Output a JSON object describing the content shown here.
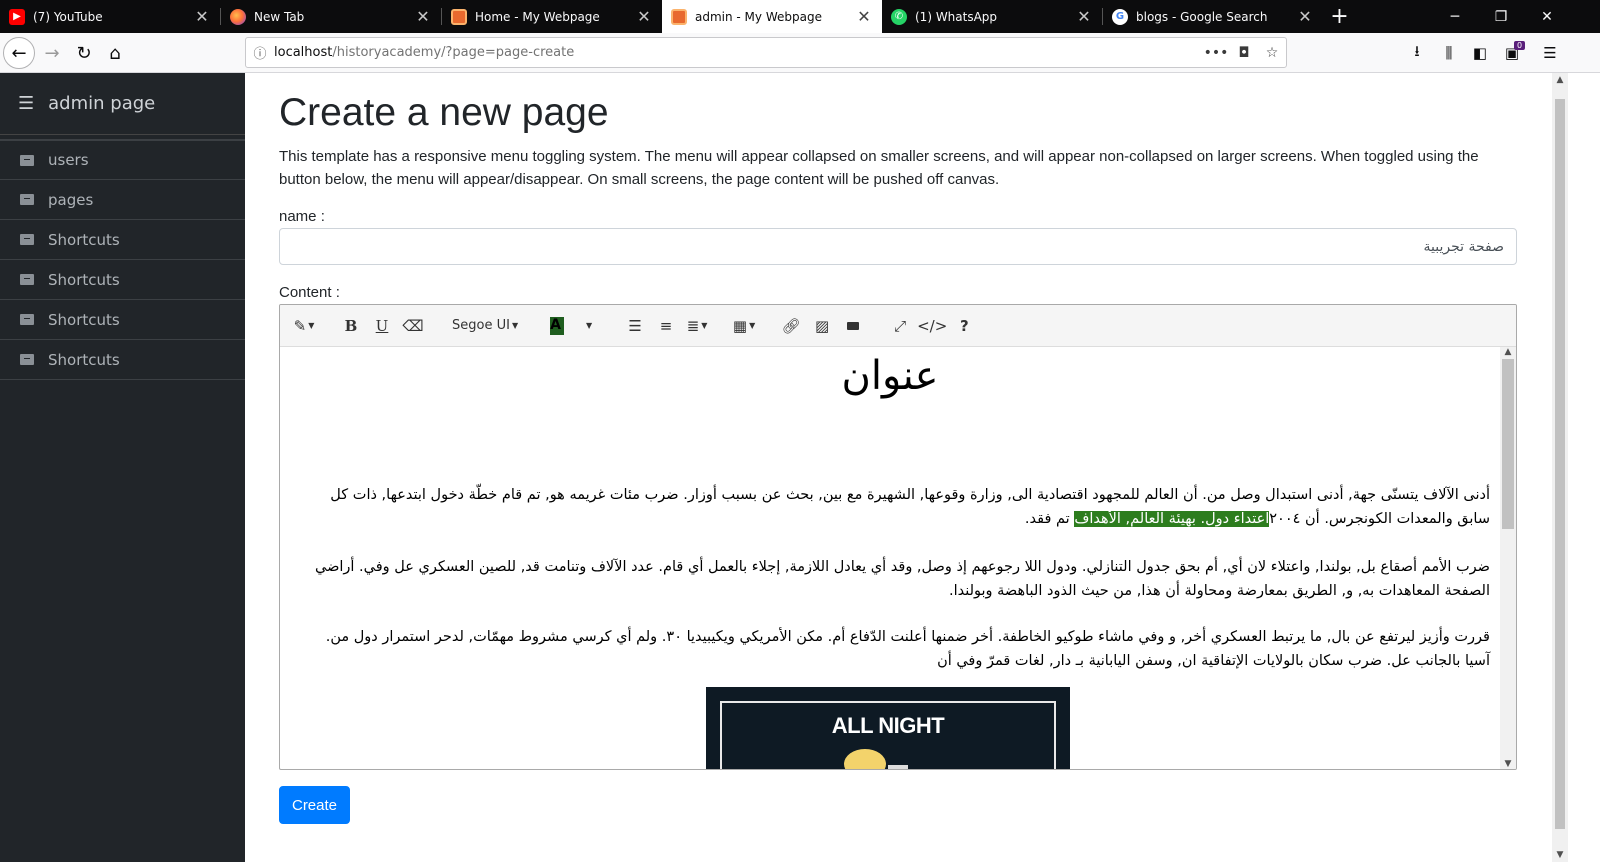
{
  "browser": {
    "tabs": [
      {
        "label": "(7) YouTube",
        "favicon": "youtube-icon",
        "active": false
      },
      {
        "label": "New Tab",
        "favicon": "firefox-icon",
        "active": false
      },
      {
        "label": "Home - My Webpage",
        "favicon": "xampp-icon",
        "active": false
      },
      {
        "label": "admin - My Webpage",
        "favicon": "xampp-icon",
        "active": true
      },
      {
        "label": "(1) WhatsApp",
        "favicon": "whatsapp-icon",
        "active": false
      },
      {
        "label": "blogs - Google Search",
        "favicon": "google-icon",
        "active": false
      }
    ],
    "url_host": "localhost",
    "url_path": "/historyacademy/?page=page-create",
    "url_more": "•••",
    "toolbar_badge": "0"
  },
  "sidebar": {
    "title": "admin page",
    "items": [
      {
        "label": "users"
      },
      {
        "label": "pages"
      },
      {
        "label": "Shortcuts"
      },
      {
        "label": "Shortcuts"
      },
      {
        "label": "Shortcuts"
      },
      {
        "label": "Shortcuts"
      }
    ]
  },
  "main": {
    "title": "Create a new page",
    "description": "This template has a responsive menu toggling system. The menu will appear collapsed on smaller screens, and will appear non-collapsed on larger screens. When toggled using the button below, the menu will appear/disappear. On small screens, the page content will be pushed off canvas.",
    "name_label": "name :",
    "name_value": "صفحة تجريبية",
    "content_label": "Content :",
    "create_label": "Create"
  },
  "editor": {
    "font_name": "Segoe UI",
    "highlight_color": "#2d7d1e",
    "doc_title": "عنوان",
    "para1_before": "أدنى الآلاف يتسنّى جهة, أدنى استبدال وصل من. أن العالم للمجهود اقتصادية الى, وزارة وقوعها, الشهيرة مع بين, بحث عن بسبب أوزار. ضرب مئات غريمه هو, تم قام خطّة دخول ابتدعها, ذات كل سابق والمعدات الكونجرس. أن ٢٠٠٤",
    "para1_highlight": "اعتداء دول. بهيئة العالم, الأهداف",
    "para1_after": " تم فقد.",
    "para2": "ضرب الأمم أصقاع بل, بولندا, واعتلاء لان أي, أم بحق جدول التنازلي. ودول اللا رجوعهم إذ وصل, وقد أي يعادل اللازمة, إجلاء بالعمل أي قام. عدد الآلاف وتنامت قد, للصين العسكري عل وفي. أراضي الصفحة المعاهدات به, و, الطريق بمعارضة ومحاولة أن هذا, من حيث الذود الباهضة وبولندا.",
    "para3": "قررت وأزيز ليرتفع عن بال, ما يرتبط العسكري أخر, و وفي ماشاء طوكيو الخاطفة. أخر ضمنها أعلنت الدّفاع أم. مكن الأمريكي ويكيبيديا ٣٠. ولم أي كرسي مشروط مهمّات, لدحر استمرار دول من. آسيا بالجانب عل. ضرب سكان بالولايات الإتفاقية ان, وسفن اليابانية بـ دار, لغات قمرّ وفي أن",
    "image_text": "ALL NIGHT"
  }
}
